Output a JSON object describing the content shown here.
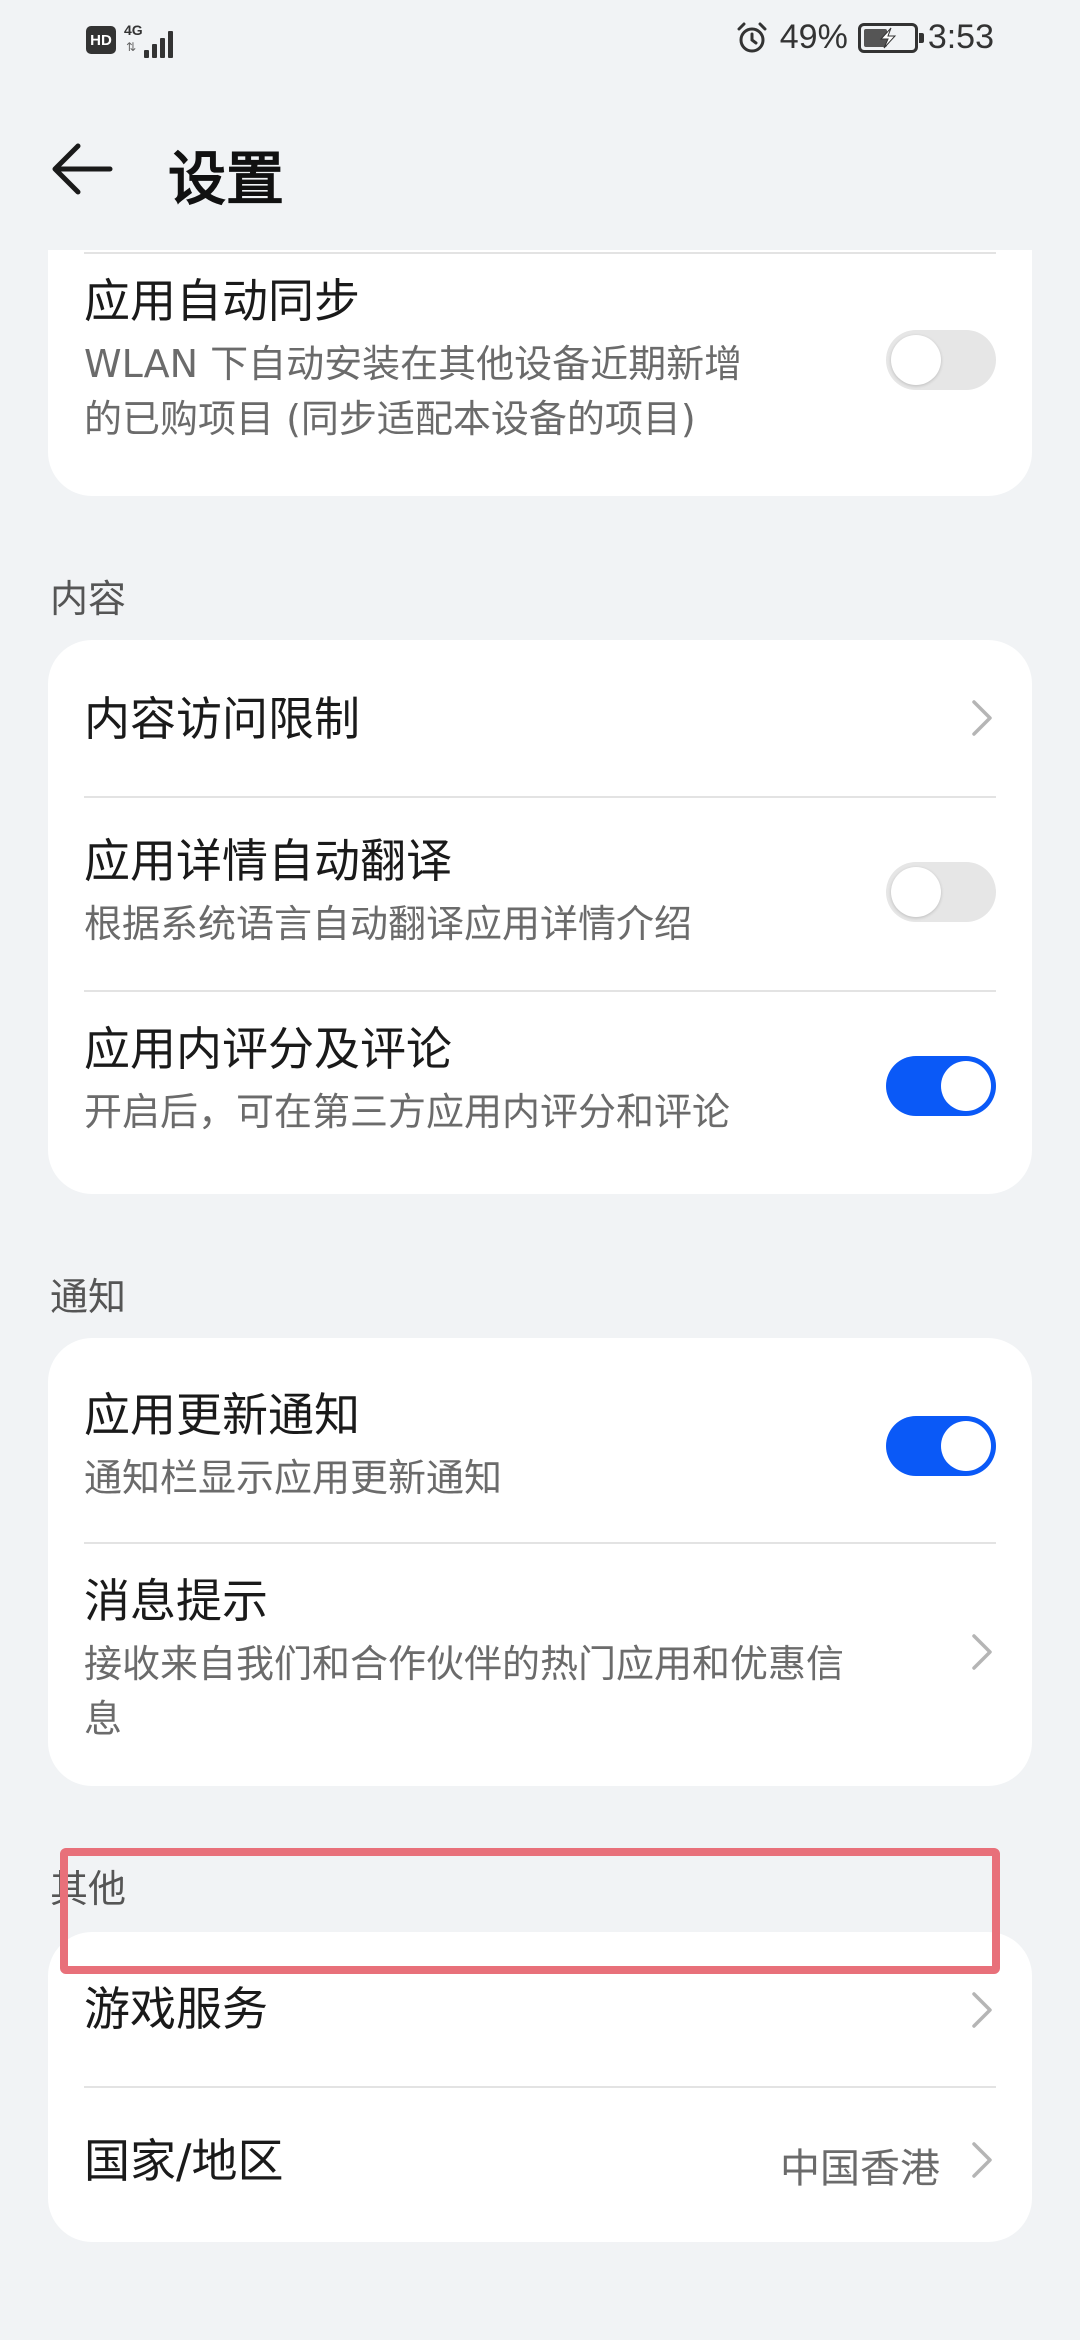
{
  "status_bar": {
    "hd": "HD",
    "network": "4G",
    "battery_percent": "49%",
    "battery_level": 49,
    "time": "3:53"
  },
  "header": {
    "title": "设置"
  },
  "sections": {
    "top": {
      "auto_sync": {
        "title": "应用自动同步",
        "subtitle_line1": "WLAN 下自动安装在其他设备近期新增",
        "subtitle_line2": "的已购项目 (同步适配本设备的项目)",
        "toggle": "off"
      }
    },
    "content": {
      "label": "内容",
      "access_limit": {
        "title": "内容访问限制"
      },
      "auto_translate": {
        "title": "应用详情自动翻译",
        "subtitle": "根据系统语言自动翻译应用详情介绍",
        "toggle": "off"
      },
      "ratings": {
        "title": "应用内评分及评论",
        "subtitle": "开启后，可在第三方应用内评分和评论",
        "toggle": "on"
      }
    },
    "notify": {
      "label": "通知",
      "update_notify": {
        "title": "应用更新通知",
        "subtitle": "通知栏显示应用更新通知",
        "toggle": "on"
      },
      "messages": {
        "title": "消息提示",
        "subtitle_line1": "接收来自我们和合作伙伴的热门应用和优惠信",
        "subtitle_line2": "息"
      }
    },
    "other": {
      "label": "其他",
      "game_service": {
        "title": "游戏服务"
      },
      "region": {
        "title": "国家/地区",
        "value": "中国香港"
      }
    }
  },
  "colors": {
    "accent": "#0a59f7",
    "background": "#f1f3f5",
    "highlight": "#e8707a"
  }
}
